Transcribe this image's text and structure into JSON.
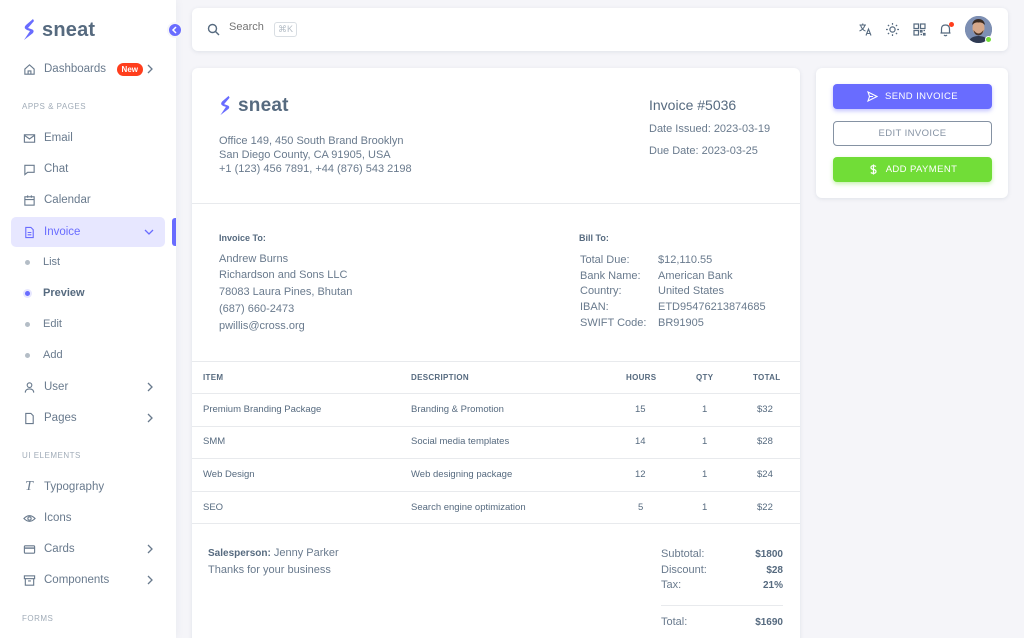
{
  "sidebar": {
    "brand": "sneat",
    "dashboards": {
      "label": "Dashboards",
      "badge": "New"
    },
    "sections": {
      "apps": "APPS & PAGES",
      "ui": "UI ELEMENTS",
      "forms": "FORMS"
    },
    "email": "Email",
    "chat": "Chat",
    "calendar": "Calendar",
    "invoice": "Invoice",
    "invoice_sub": {
      "list": "List",
      "preview": "Preview",
      "edit": "Edit",
      "add": "Add"
    },
    "user": "User",
    "pages": "Pages",
    "typography": "Typography",
    "icons": "Icons",
    "cards": "Cards",
    "components": "Components"
  },
  "navbar": {
    "search_placeholder": "Search",
    "shortcut": "⌘K"
  },
  "invoice": {
    "brand": "sneat",
    "address": [
      "Office 149, 450 South Brand Brooklyn",
      "San Diego County, CA 91905, USA",
      "+1 (123) 456 7891, +44 (876) 543 2198"
    ],
    "title": "Invoice #5036",
    "date_issued": "Date Issued: 2023-03-19",
    "due_date": "Due Date: 2023-03-25",
    "invoice_to_label": "Invoice To:",
    "client": [
      "Andrew Burns",
      "Richardson and Sons LLC",
      "78083 Laura Pines, Bhutan",
      "(687) 660-2473",
      "pwillis@cross.org"
    ],
    "bill_to_label": "Bill To:",
    "bill": [
      {
        "k": "Total Due:",
        "v": "$12,110.55"
      },
      {
        "k": "Bank Name:",
        "v": "American Bank"
      },
      {
        "k": "Country:",
        "v": "United States"
      },
      {
        "k": "IBAN:",
        "v": "ETD95476213874685"
      },
      {
        "k": "SWIFT Code:",
        "v": "BR91905"
      }
    ],
    "table": {
      "headers": {
        "item": "ITEM",
        "description": "DESCRIPTION",
        "hours": "HOURS",
        "qty": "QTY",
        "total": "TOTAL"
      },
      "rows": [
        {
          "item": "Premium Branding Package",
          "description": "Branding & Promotion",
          "hours": "15",
          "qty": "1",
          "total": "$32"
        },
        {
          "item": "SMM",
          "description": "Social media templates",
          "hours": "14",
          "qty": "1",
          "total": "$28"
        },
        {
          "item": "Web Design",
          "description": "Web designing package",
          "hours": "12",
          "qty": "1",
          "total": "$24"
        },
        {
          "item": "SEO",
          "description": "Search engine optimization",
          "hours": "5",
          "qty": "1",
          "total": "$22"
        }
      ]
    },
    "salesperson_label": "Salesperson:",
    "salesperson": "Jenny Parker",
    "thanks": "Thanks for your business",
    "totals": {
      "subtotal_k": "Subtotal:",
      "subtotal_v": "$1800",
      "discount_k": "Discount:",
      "discount_v": "$28",
      "tax_k": "Tax:",
      "tax_v": "21%",
      "total_k": "Total:",
      "total_v": "$1690"
    }
  },
  "actions": {
    "send": "SEND INVOICE",
    "edit": "EDIT INVOICE",
    "payment": "ADD PAYMENT"
  },
  "colors": {
    "primary": "#696cff",
    "success": "#71dd37",
    "danger": "#ff3e1d",
    "background": "#f5f5f9"
  }
}
